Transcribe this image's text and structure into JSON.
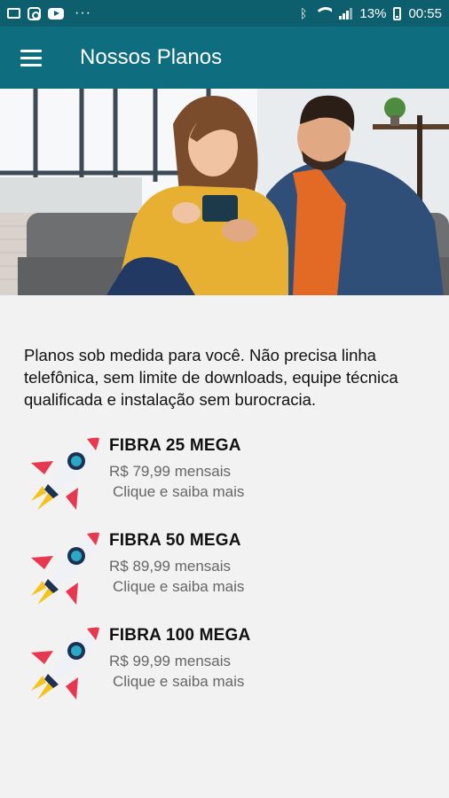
{
  "status_bar": {
    "battery": "13%",
    "time": "00:55",
    "icons": [
      "image-icon",
      "instagram-icon",
      "youtube-icon",
      "more-icon",
      "bluetooth-icon",
      "wifi-icon",
      "signal-icon",
      "battery-icon"
    ]
  },
  "app_bar": {
    "title": "Nossos Planos",
    "menu_icon": "hamburger-menu-icon"
  },
  "hero": {
    "image": "couple-looking-at-phone-photo"
  },
  "intro": {
    "text": "Planos sob medida para você. Não precisa linha telefônica, sem limite de downloads, equipe técnica qualificada e instalação sem burocracia."
  },
  "plans": [
    {
      "name": "FIBRA 25 MEGA",
      "price": "R$ 79,99 mensais",
      "cta": "Clique e saiba mais",
      "icon": "rocket-icon"
    },
    {
      "name": "FIBRA 50 MEGA",
      "price": "R$ 89,99 mensais",
      "cta": "Clique e saiba mais",
      "icon": "rocket-icon"
    },
    {
      "name": "FIBRA 100 MEGA",
      "price": "R$ 99,99 mensais",
      "cta": "Clique e saiba mais",
      "icon": "rocket-icon"
    }
  ],
  "colors": {
    "status_bar": "#0e5f6e",
    "app_bar": "#0f6d80",
    "background": "#f2f2f2",
    "rocket_red": "#e8384f",
    "rocket_navy": "#1d3153",
    "rocket_teal": "#2aa9c4",
    "rocket_flame": "#f6c31a"
  }
}
